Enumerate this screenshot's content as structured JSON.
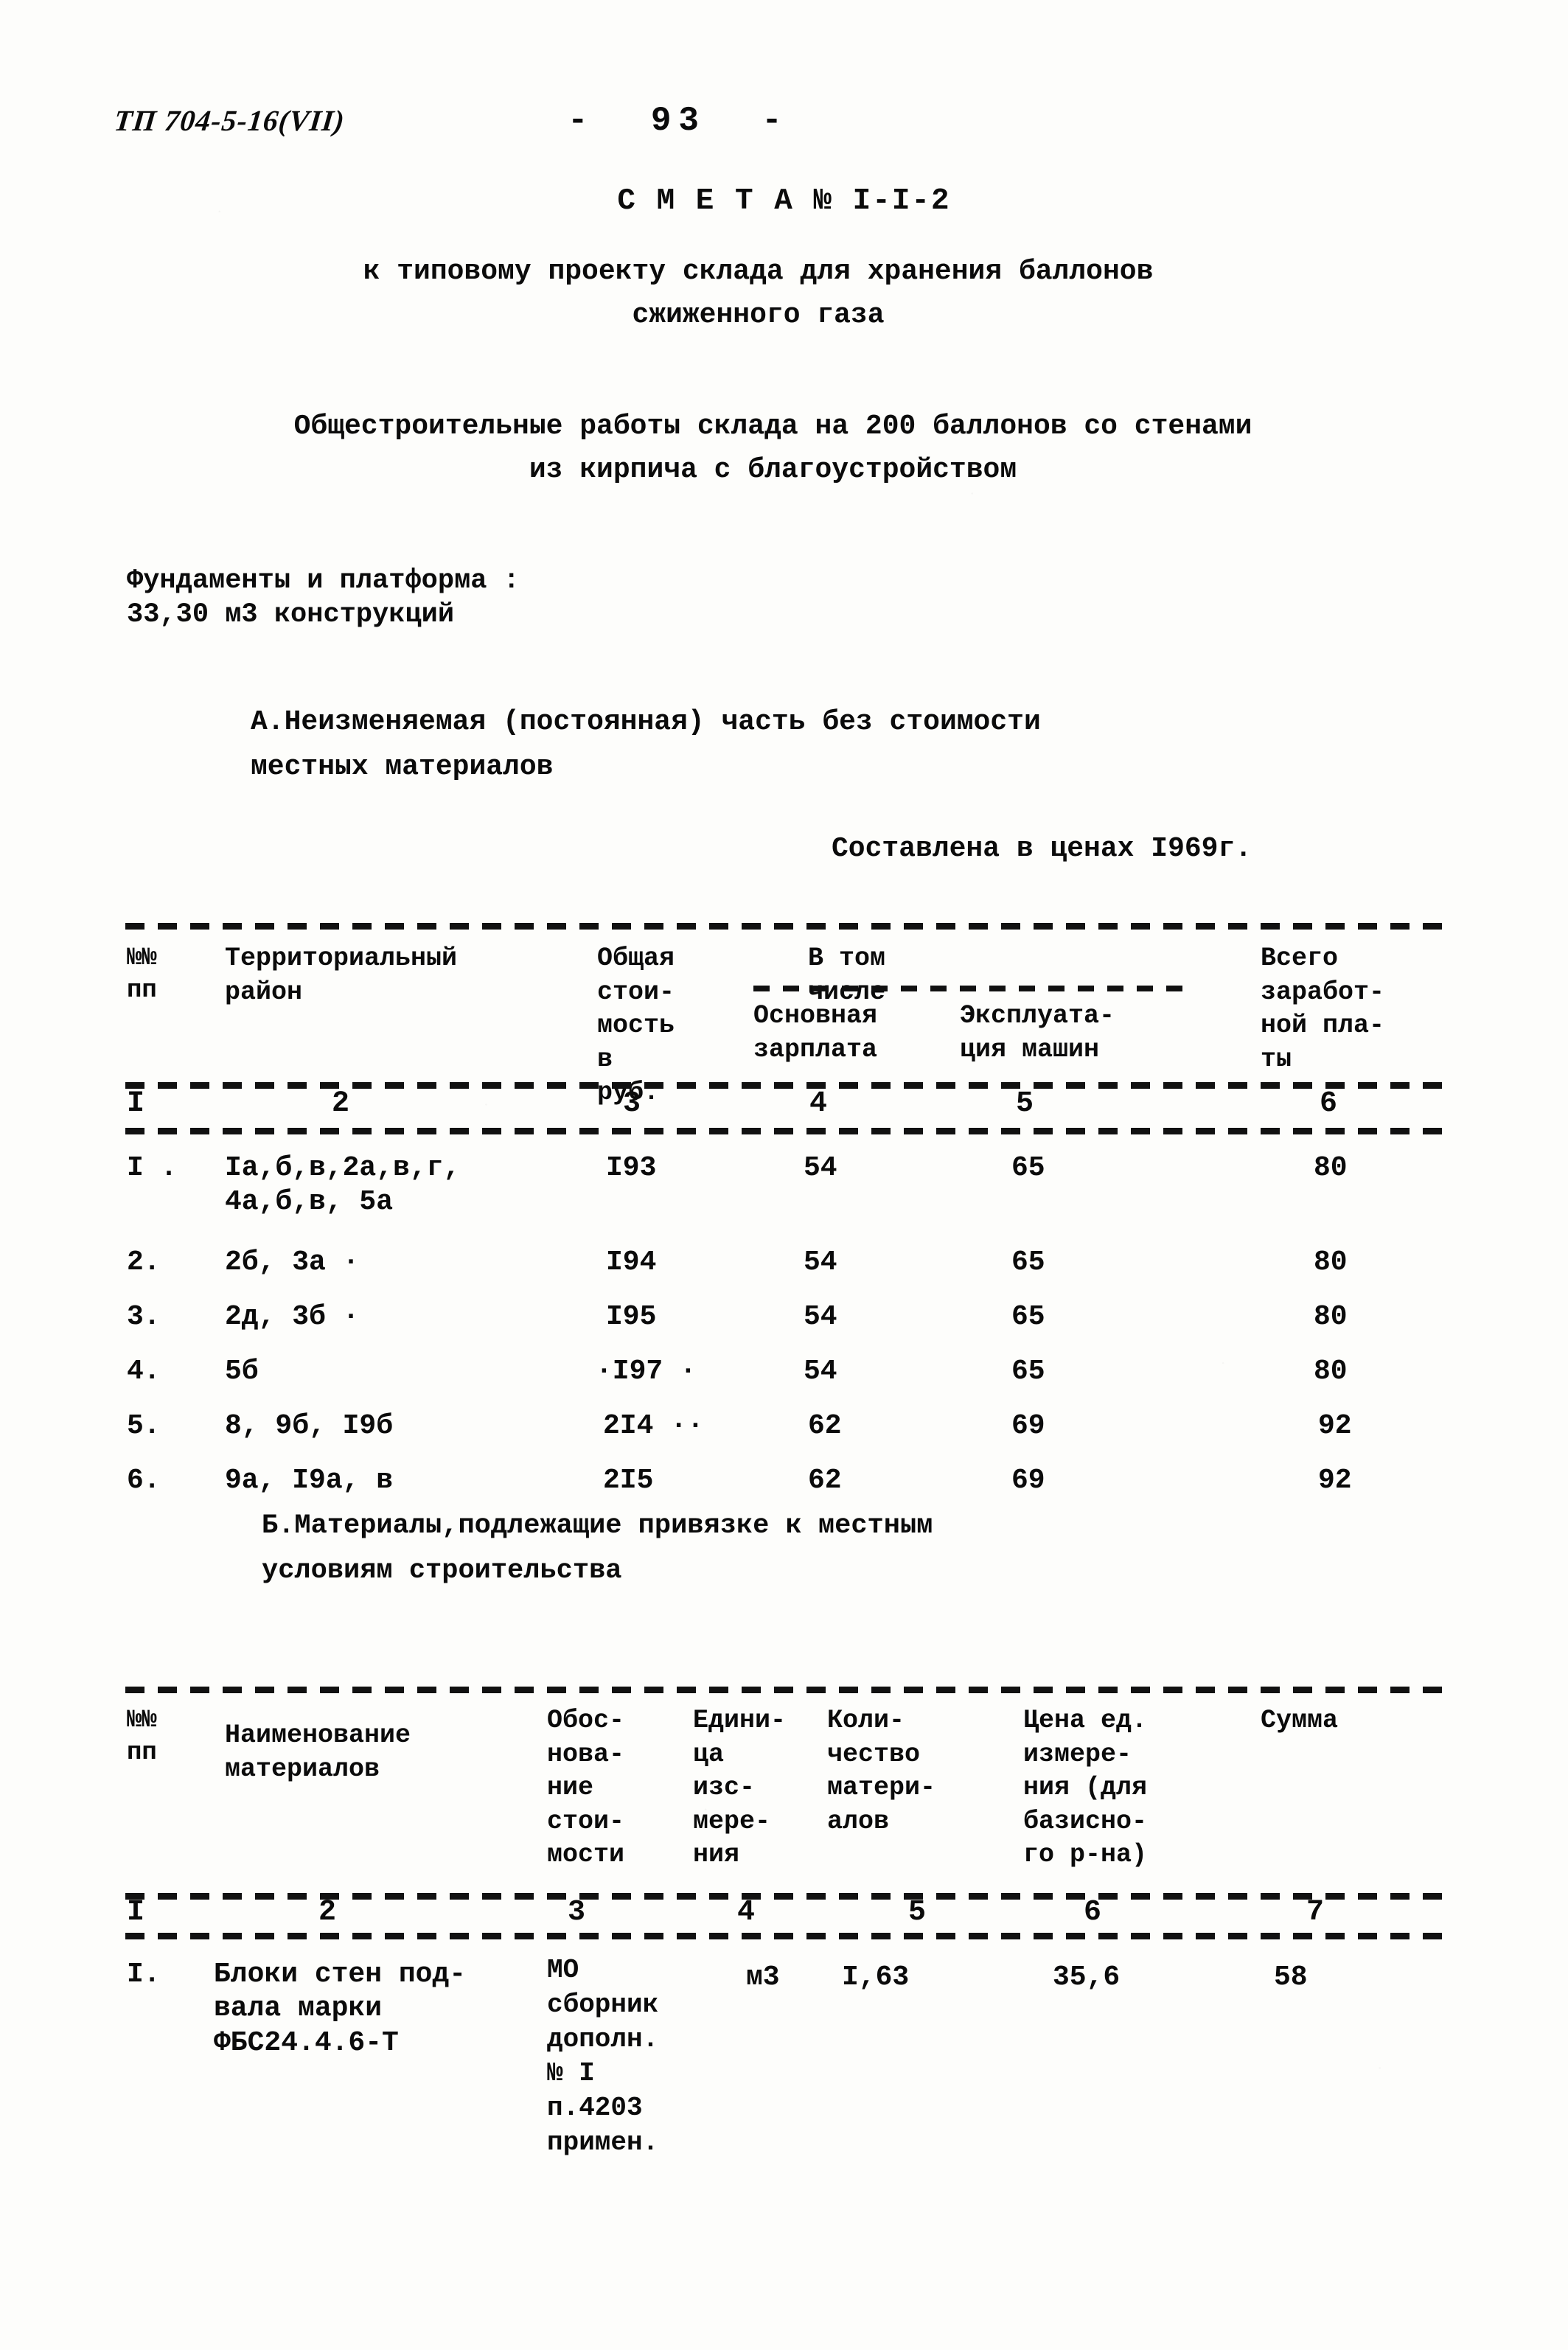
{
  "header": {
    "doc_code": "ТП 704-5-16(VII)",
    "page_number": "-  93  -"
  },
  "title": {
    "main": "С М Е Т А № I-I-2",
    "subtitle_1": "к типовому проекту склада для хранения баллонов\nсжиженного газа",
    "subtitle_2": "Общестроительные работы склада на 200 баллонов со стенами\nиз кирпича с благоустройством"
  },
  "foundations": {
    "text": "Фундаменты и платформа :\n33,30 м3 конструкций"
  },
  "section_a": {
    "heading": "А.Неизменяемая (постоянная) часть без стоимости\n      местных материалов",
    "prices_note": "Составлена в ценах I969г."
  },
  "table_a": {
    "headers": {
      "col1": "№№\nпп",
      "col2": "Территориальный\n        район",
      "col3": "Общая\nстои-\nмость\nв руб.",
      "group": "В том числе",
      "col4": "Основная\nзарплата",
      "col5": "Эксплуата-\nция машин",
      "col6": "Всего\nзаработ-\nной пла-\nты"
    },
    "colnums": [
      "I",
      "2",
      "3",
      "4",
      "5",
      "6"
    ],
    "rows": [
      {
        "no": "I .",
        "region": "Iа,б,в,2а,в,г,\n4а,б,в, 5а",
        "total": "I93",
        "wages": "54",
        "machines": "65",
        "all_wages": "80"
      },
      {
        "no": "2.",
        "region": "2б, 3а       ·",
        "total": "I94",
        "wages": "54",
        "machines": "65",
        "all_wages": "80"
      },
      {
        "no": "3.",
        "region": "2д, 3б ·",
        "total": "I95",
        "wages": "54",
        "machines": "65",
        "all_wages": "80"
      },
      {
        "no": "4.",
        "region": "5б",
        "total": "·I97 ·",
        "wages": "54",
        "machines": "65",
        "all_wages": "80"
      },
      {
        "no": "5.",
        "region": "8, 9б, I9б",
        "total": "2I4 ··",
        "wages": "62",
        "machines": "69",
        "all_wages": "92"
      },
      {
        "no": "6.",
        "region": "9а, I9а, в",
        "total": "2I5",
        "wages": "62",
        "machines": "69",
        "all_wages": "92"
      }
    ]
  },
  "section_b": {
    "heading": "Б.Материалы,подлежащие привязке к местным\n  условиям строительства"
  },
  "table_b": {
    "headers": {
      "col1": "№№\nпп",
      "col2": "Наименование\nматериалов",
      "col3": "Обос-\nнова-\nние\nстои-\nмости",
      "col4": "Едини-\nца изс-\nмере-\nния",
      "col5": "Коли-\nчество\nматери-\nалов",
      "col6": "Цена ед.\nизмере-\nния (для\nбазисно-\nго р-на)",
      "col7": "Сумма"
    },
    "colnums": [
      "I",
      "2",
      "3",
      "4",
      "5",
      "6",
      "7"
    ],
    "rows": [
      {
        "no": "I.",
        "material": "Блоки стен под-\nвала марки\nФБС24.4.6-Т",
        "basis": "МО\nсборник\nдополн.\n№ I\nп.4203\nпримен.",
        "unit": "м3",
        "qty": "I,63",
        "price": "35,6",
        "sum": "58"
      }
    ]
  }
}
